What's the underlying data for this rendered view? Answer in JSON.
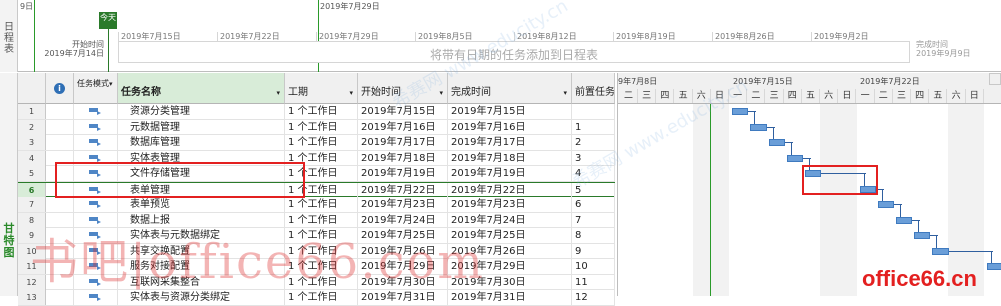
{
  "timeline": {
    "side_label": "日程表",
    "top_left_day": "9日",
    "top_date": "2019年7月29日",
    "today_label": "今天",
    "start_caption": "开始时间",
    "start_date": "2019年7月14日",
    "finish_caption": "完成时间",
    "finish_date": "2019年9月9日",
    "placeholder": "将带有日期的任务添加到日程表",
    "ticks": [
      "2019年7月15日",
      "2019年7月22日",
      "2019年7月29日",
      "2019年8月5日",
      "2019年8月12日",
      "2019年8月19日",
      "2019年8月26日",
      "2019年9月2日"
    ]
  },
  "gantt": {
    "side_label": "甘特图",
    "columns": {
      "info_icon": "info-icon",
      "mode": "任务模式",
      "name": "任务名称",
      "duration": "工期",
      "start": "开始时间",
      "finish": "完成时间",
      "predecessors": "前置任务"
    },
    "rows": [
      {
        "id": "1",
        "name": "资源分类管理",
        "duration": "1 个工作日",
        "start": "2019年7月15日",
        "finish": "2019年7月15日",
        "pred": ""
      },
      {
        "id": "2",
        "name": "元数据管理",
        "duration": "1 个工作日",
        "start": "2019年7月16日",
        "finish": "2019年7月16日",
        "pred": "1"
      },
      {
        "id": "3",
        "name": "数据库管理",
        "duration": "1 个工作日",
        "start": "2019年7月17日",
        "finish": "2019年7月17日",
        "pred": "2"
      },
      {
        "id": "4",
        "name": "实体表管理",
        "duration": "1 个工作日",
        "start": "2019年7月18日",
        "finish": "2019年7月18日",
        "pred": "3"
      },
      {
        "id": "5",
        "name": "文件存储管理",
        "duration": "1 个工作日",
        "start": "2019年7月19日",
        "finish": "2019年7月19日",
        "pred": "4"
      },
      {
        "id": "6",
        "name": "表单管理",
        "duration": "1 个工作日",
        "start": "2019年7月22日",
        "finish": "2019年7月22日",
        "pred": "5"
      },
      {
        "id": "7",
        "name": "表单预览",
        "duration": "1 个工作日",
        "start": "2019年7月23日",
        "finish": "2019年7月23日",
        "pred": "6"
      },
      {
        "id": "8",
        "name": "数据上报",
        "duration": "1 个工作日",
        "start": "2019年7月24日",
        "finish": "2019年7月24日",
        "pred": "7"
      },
      {
        "id": "9",
        "name": "实体表与元数据绑定",
        "duration": "1 个工作日",
        "start": "2019年7月25日",
        "finish": "2019年7月25日",
        "pred": "8"
      },
      {
        "id": "10",
        "name": "共享交换配置",
        "duration": "1 个工作日",
        "start": "2019年7月26日",
        "finish": "2019年7月26日",
        "pred": "9"
      },
      {
        "id": "11",
        "name": "服务对接配置",
        "duration": "1 个工作日",
        "start": "2019年7月29日",
        "finish": "2019年7月29日",
        "pred": "10"
      },
      {
        "id": "12",
        "name": "互联网采集整合",
        "duration": "1 个工作日",
        "start": "2019年7月30日",
        "finish": "2019年7月30日",
        "pred": "11"
      },
      {
        "id": "13",
        "name": "实体表与资源分类绑定",
        "duration": "1 个工作日",
        "start": "2019年7月31日",
        "finish": "2019年7月31日",
        "pred": "12"
      }
    ]
  },
  "chart": {
    "weeks": [
      "9年7月8日",
      "2019年7月15日",
      "2019年7月22日"
    ],
    "days": [
      "二",
      "三",
      "四",
      "五",
      "六",
      "日",
      "一",
      "二",
      "三",
      "四",
      "五",
      "六",
      "日",
      "一",
      "二",
      "三",
      "四",
      "五",
      "六",
      "日"
    ]
  },
  "watermark": {
    "overlay": "书吧|office66.com",
    "site": "office66.cn",
    "faint": "希赛网 www.educity.cn"
  },
  "colors": {
    "accent": "#2a7a2a",
    "bar": "#6a9ed8",
    "highlight": "#e32020"
  }
}
